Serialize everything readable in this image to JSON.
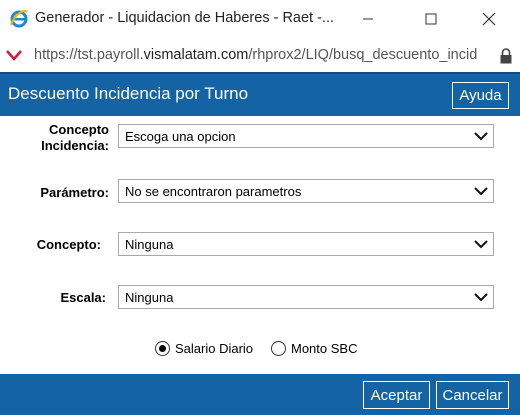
{
  "window": {
    "title": "Generador - Liquidacion de Haberes - Raet -...",
    "icon": "ie-icon"
  },
  "address": {
    "url_prefix": "https://tst.payroll.",
    "url_domain": "vismalatam.com",
    "url_suffix": "/rhprox2/LIQ/busq_descuento_incid"
  },
  "header": {
    "title": "Descuento Incidencia por Turno",
    "help_label": "Ayuda"
  },
  "form": {
    "concepto_incidencia_label_1": "Concepto",
    "concepto_incidencia_label_2": "Incidencia:",
    "concepto_incidencia_value": "Escoga una opcion",
    "parametro_label": "Parámetro:",
    "parametro_value": "No se encontraron parametros",
    "concepto_label": "Concepto:",
    "concepto_value": "Ninguna",
    "escala_label": "Escala:",
    "escala_value": "Ninguna"
  },
  "radios": {
    "option1": "Salario Diario",
    "option2": "Monto SBC",
    "selected": "option1"
  },
  "footer": {
    "accept_label": "Aceptar",
    "cancel_label": "Cancelar"
  },
  "colors": {
    "brand_blue": "#1464a5"
  }
}
